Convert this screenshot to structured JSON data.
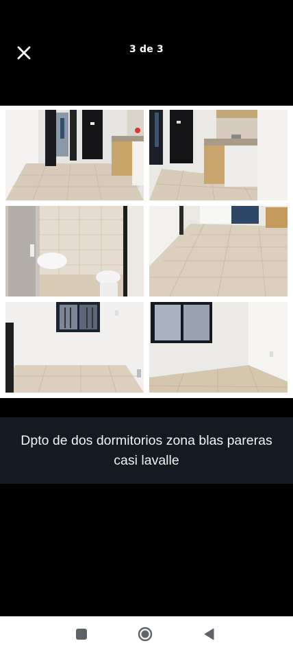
{
  "header": {
    "counter": "3 de 3",
    "close_icon": "close-icon"
  },
  "gallery": {
    "photos": [
      {
        "name": "kitchen-hall-photo",
        "icon": "photo"
      },
      {
        "name": "kitchen-counter-photo",
        "icon": "photo"
      },
      {
        "name": "bathroom-photo",
        "icon": "photo"
      },
      {
        "name": "living-room-photo",
        "icon": "photo"
      },
      {
        "name": "bedroom-one-photo",
        "icon": "photo"
      },
      {
        "name": "bedroom-two-photo",
        "icon": "photo"
      }
    ]
  },
  "caption": {
    "text": "Dpto de dos dormitorios zona blas pareras casi lavalle"
  },
  "navbar": {
    "recents_icon": "recents-square-icon",
    "home_icon": "home-circle-icon",
    "back_icon": "back-triangle-icon"
  },
  "colors": {
    "background": "#000000",
    "caption_background": "#141a21",
    "caption_text": "#f2f2f2",
    "navbar": "#ffffff",
    "nav_icons": "#5f6368"
  }
}
